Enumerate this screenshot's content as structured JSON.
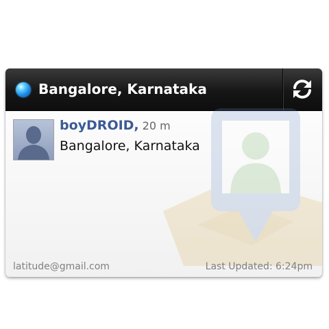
{
  "header": {
    "title": "Bangalore, Karnataka",
    "status_icon": "blue-orb-icon",
    "refresh_icon": "refresh-icon"
  },
  "user": {
    "name": "boyDROID,",
    "time_ago": "20 m",
    "location": "Bangalore, Karnataka",
    "avatar_icon": "person-silhouette-icon"
  },
  "footer": {
    "email": "latitude@gmail.com",
    "last_updated": "Last Updated: 6:24pm"
  },
  "colors": {
    "header_bg": "#161616",
    "name": "#3c5a96",
    "status_dot": "#1a88e0",
    "footer_text": "#808080"
  }
}
